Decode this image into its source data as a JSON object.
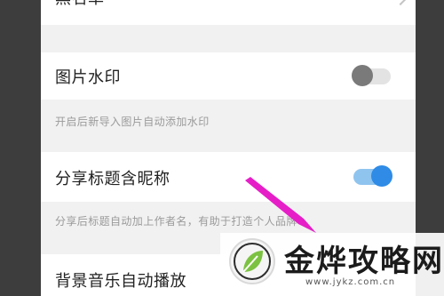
{
  "settings": {
    "blacklist_label": "黑名单",
    "image_watermark": {
      "label": "图片水印",
      "hint": "开启后新导入图片自动添加水印",
      "enabled": false
    },
    "share_title_nickname": {
      "label": "分享标题含昵称",
      "hint": "分享后标题自动加上作者名，有助于打造个人品牌",
      "enabled": true
    },
    "bg_music_autoplay": {
      "label": "背景音乐自动播放"
    }
  },
  "watermark": {
    "title": "金烨攻略网",
    "url": "www.jykz.com.cn"
  },
  "colors": {
    "toggle_on": "#2f8be6",
    "toggle_off": "#7a7a7a",
    "annotation_arrow": "#e61ec8"
  },
  "icons": {
    "chevron": "chevron-right-icon",
    "logo": "leaf-logo-icon",
    "arrow": "annotation-arrow-icon"
  }
}
